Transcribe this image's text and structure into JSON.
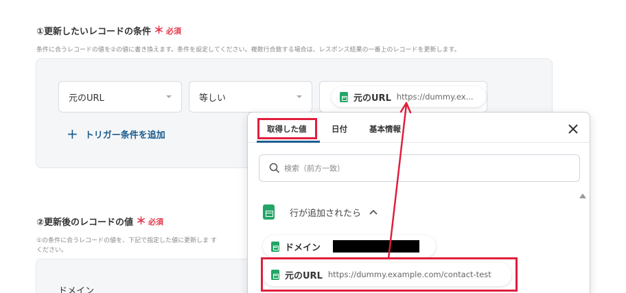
{
  "section1": {
    "title": "①更新したいレコードの条件",
    "required": "必須",
    "description": "条件に合うレコードの値を②の値に書き換えます。条件を設定してください。複数行合致する場合は、レスポンス結果の一番上のレコードを更新します。",
    "field_select": "元のURL",
    "operator_select": "等しい",
    "value_chip_label": "元のURL",
    "value_chip_value": "https://dummy.ex...",
    "add_trigger_label": "トリガー条件を追加"
  },
  "section2": {
    "title": "②更新後のレコードの値",
    "required": "必須",
    "description_line1": "①の条件に合うレコードの値を、下記で指定した値に更新しま す",
    "description_line2": "ください。",
    "field_label": "ドメイン"
  },
  "popup": {
    "tabs": [
      {
        "label": "取得した値"
      },
      {
        "label": "日付"
      },
      {
        "label": "基本情報"
      }
    ],
    "search_placeholder": "検索（前方一致）",
    "group_label": "行が追加されたら",
    "items": [
      {
        "label": "ドメイン",
        "value": ""
      },
      {
        "label": "元のURL",
        "value": "https://dummy.example.com/contact-test"
      }
    ]
  },
  "colors": {
    "required_red": "#e2364a",
    "annotation_red": "#e01e3c",
    "sheets_green": "#23a566",
    "link_blue": "#1a5c8e"
  }
}
